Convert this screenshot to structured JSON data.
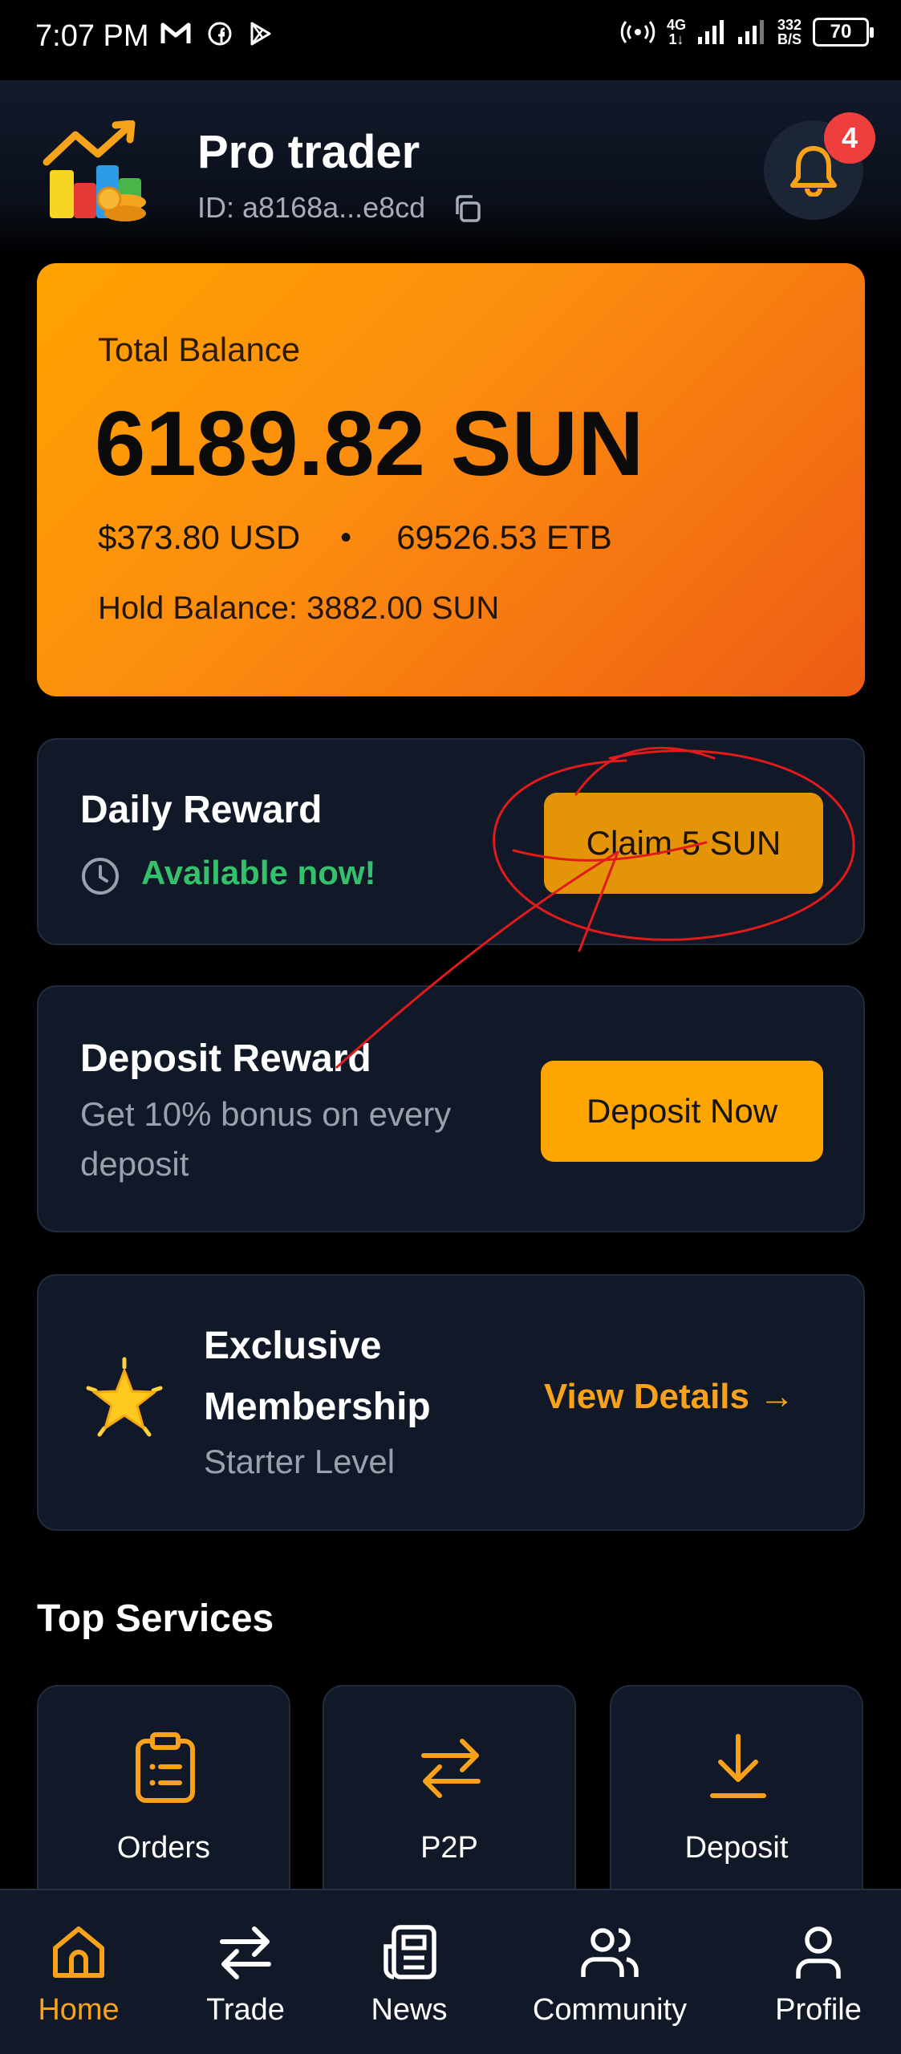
{
  "status_bar": {
    "time": "7:07 PM",
    "network_top": "4G",
    "network_bottom": "1↓",
    "speed_top": "332",
    "speed_bottom": "B/S",
    "battery": "70"
  },
  "header": {
    "name": "Pro trader",
    "id_text": "ID: a8168a...e8cd",
    "notification_count": "4",
    "logo_icon": "trading-chart-logo-icon"
  },
  "balance": {
    "label": "Total Balance",
    "amount": "6189.82 SUN",
    "usd": "$373.80 USD",
    "separator": "•",
    "etb": "69526.53 ETB",
    "hold": "Hold Balance: 3882.00 SUN"
  },
  "daily_reward": {
    "title": "Daily Reward",
    "status": "Available now!",
    "button": "Claim 5 SUN"
  },
  "deposit_reward": {
    "title": "Deposit Reward",
    "subtitle": "Get 10% bonus on every deposit",
    "button": "Deposit Now"
  },
  "membership": {
    "title_line1": "Exclusive",
    "title_line2": "Membership",
    "level": "Starter Level",
    "link": "View Details →"
  },
  "services": {
    "title": "Top Services",
    "items": [
      {
        "label": "Orders",
        "icon": "clipboard-icon"
      },
      {
        "label": "P2P",
        "icon": "swap-arrows-icon"
      },
      {
        "label": "Deposit",
        "icon": "download-icon"
      }
    ]
  },
  "nav": {
    "items": [
      {
        "label": "Home",
        "icon": "home-icon",
        "active": true
      },
      {
        "label": "Trade",
        "icon": "swap-arrows-icon",
        "active": false
      },
      {
        "label": "News",
        "icon": "newspaper-icon",
        "active": false
      },
      {
        "label": "Community",
        "icon": "users-icon",
        "active": false
      },
      {
        "label": "Profile",
        "icon": "user-icon",
        "active": false
      }
    ]
  },
  "colors": {
    "accent": "#f7a21a",
    "green": "#35c16c",
    "card_bg": "#111827",
    "badge": "#ef3e3e",
    "annotation": "#e01b1b"
  }
}
